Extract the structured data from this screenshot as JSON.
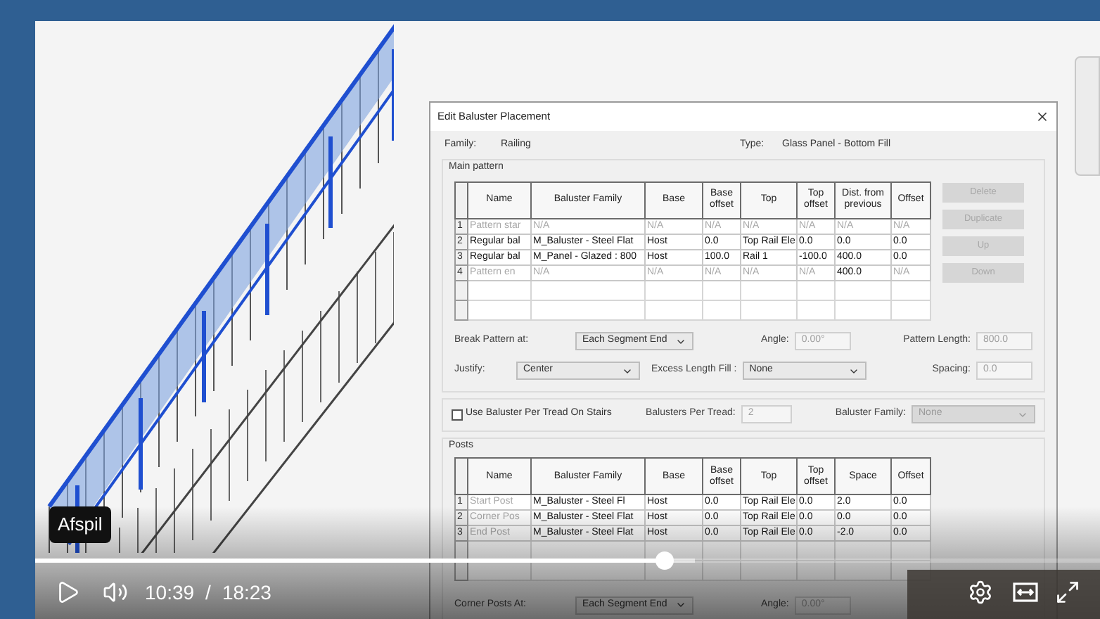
{
  "player": {
    "tooltip": "Afspil",
    "progress": {
      "level": 0.59
    },
    "time_current": "10:39",
    "time_separator": "/",
    "time_total": "18:23"
  },
  "dialog": {
    "title": "Edit Baluster Placement",
    "family_label": "Family:",
    "family_value": "Railing",
    "type_label": "Type:",
    "type_value": "Glass Panel - Bottom Fill",
    "main_pattern": {
      "title": "Main pattern",
      "columns": [
        "Name",
        "Baluster Family",
        "Base",
        "Base offset",
        "Top",
        "Top offset",
        "Dist. from previous",
        "Offset"
      ],
      "rows": [
        {
          "number": "1",
          "cells": [
            {
              "text": "Pattern star",
              "disabled": true
            },
            {
              "text": "N/A",
              "disabled": true
            },
            {
              "text": "N/A",
              "disabled": true
            },
            {
              "text": "N/A",
              "disabled": true
            },
            {
              "text": "N/A",
              "disabled": true
            },
            {
              "text": "N/A",
              "disabled": true
            },
            {
              "text": "N/A",
              "disabled": true
            },
            {
              "text": "N/A",
              "disabled": true
            }
          ]
        },
        {
          "number": "2",
          "cells": [
            {
              "text": "Regular bal",
              "disabled": false
            },
            {
              "text": "M_Baluster - Steel Flat",
              "disabled": false
            },
            {
              "text": "Host",
              "disabled": false
            },
            {
              "text": "0.0",
              "disabled": false
            },
            {
              "text": "Top Rail Ele",
              "disabled": false
            },
            {
              "text": "0.0",
              "disabled": false
            },
            {
              "text": "0.0",
              "disabled": false
            },
            {
              "text": "0.0",
              "disabled": false
            }
          ]
        },
        {
          "number": "3",
          "cells": [
            {
              "text": "Regular bal",
              "disabled": false
            },
            {
              "text": "M_Panel - Glazed : 800",
              "disabled": false
            },
            {
              "text": "Host",
              "disabled": false
            },
            {
              "text": "100.0",
              "disabled": false
            },
            {
              "text": "Rail 1",
              "disabled": false
            },
            {
              "text": "-100.0",
              "disabled": false
            },
            {
              "text": "400.0",
              "disabled": false
            },
            {
              "text": "0.0",
              "disabled": false
            }
          ]
        },
        {
          "number": "4",
          "cells": [
            {
              "text": "Pattern en",
              "disabled": true
            },
            {
              "text": "N/A",
              "disabled": true
            },
            {
              "text": "N/A",
              "disabled": true
            },
            {
              "text": "N/A",
              "disabled": true
            },
            {
              "text": "N/A",
              "disabled": true
            },
            {
              "text": "N/A",
              "disabled": true
            },
            {
              "text": "400.0",
              "disabled": false
            },
            {
              "text": "N/A",
              "disabled": true
            }
          ]
        }
      ],
      "buttons": [
        {
          "label": "Delete",
          "disabled": true
        },
        {
          "label": "Duplicate",
          "disabled": true
        },
        {
          "label": "Up",
          "disabled": true
        },
        {
          "label": "Down",
          "disabled": true
        }
      ],
      "break_label": "Break Pattern at:",
      "break_value": "Each Segment End",
      "angle_label": "Angle:",
      "angle_value": "0.00°",
      "length_label": "Pattern Length:",
      "length_value": "800.0",
      "justify_label": "Justify:",
      "justify_value": "Center",
      "excess_label": "Excess Length Fill :",
      "excess_value": "None",
      "spacing_label": "Spacing:",
      "spacing_value": "0.0"
    },
    "per_tread": {
      "checkbox_label": "Use Baluster Per Tread On Stairs",
      "checked": false,
      "count_label": "Balusters Per Tread:",
      "count_value": "2",
      "family_label": "Baluster Family:",
      "family_value": "None"
    },
    "posts": {
      "title": "Posts",
      "columns": [
        "Name",
        "Baluster Family",
        "Base",
        "Base offset",
        "Top",
        "Top offset",
        "Space",
        "Offset"
      ],
      "rows": [
        {
          "number": "1",
          "cells": [
            {
              "text": "Start Post",
              "disabled": true
            },
            {
              "text": "M_Baluster - Steel Fl",
              "disabled": false
            },
            {
              "text": "Host",
              "disabled": false
            },
            {
              "text": "0.0",
              "disabled": false
            },
            {
              "text": "Top Rail Ele",
              "disabled": false
            },
            {
              "text": "0.0",
              "disabled": false
            },
            {
              "text": "2.0",
              "disabled": false
            },
            {
              "text": "0.0",
              "disabled": false
            }
          ]
        },
        {
          "number": "2",
          "cells": [
            {
              "text": "Corner Pos",
              "disabled": true
            },
            {
              "text": "M_Baluster - Steel Flat",
              "disabled": false
            },
            {
              "text": "Host",
              "disabled": false
            },
            {
              "text": "0.0",
              "disabled": false
            },
            {
              "text": "Top Rail Ele",
              "disabled": false
            },
            {
              "text": "0.0",
              "disabled": false
            },
            {
              "text": "0.0",
              "disabled": false
            },
            {
              "text": "0.0",
              "disabled": false
            }
          ]
        },
        {
          "number": "3",
          "cells": [
            {
              "text": "End Post",
              "disabled": true
            },
            {
              "text": "M_Baluster - Steel Flat",
              "disabled": false
            },
            {
              "text": "Host",
              "disabled": false
            },
            {
              "text": "0.0",
              "disabled": false
            },
            {
              "text": "Top Rail Ele",
              "disabled": false
            },
            {
              "text": "0.0",
              "disabled": false
            },
            {
              "text": "-2.0",
              "disabled": false
            },
            {
              "text": "0.0",
              "disabled": false
            }
          ]
        }
      ],
      "corner_label": "Corner Posts At:",
      "corner_value": "Each Segment End",
      "angle_label": "Angle:",
      "angle_value": "0.00°"
    }
  }
}
